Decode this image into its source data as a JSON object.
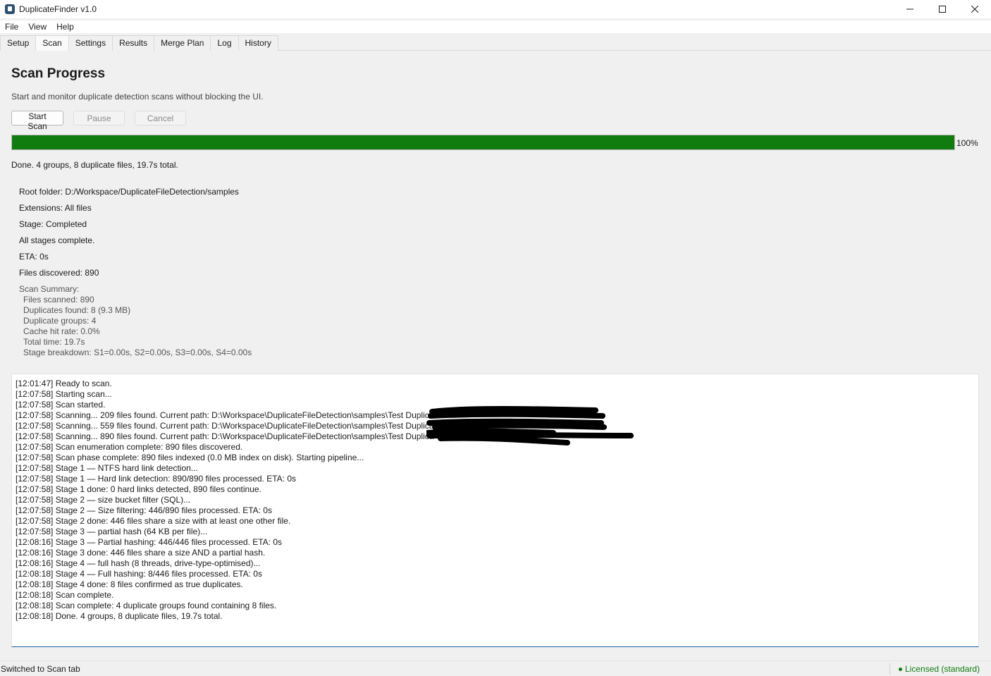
{
  "window": {
    "title": "DuplicateFinder v1.0"
  },
  "menu": [
    "File",
    "View",
    "Help"
  ],
  "tabs": [
    {
      "label": "Setup"
    },
    {
      "label": "Scan",
      "active": true
    },
    {
      "label": "Settings"
    },
    {
      "label": "Results"
    },
    {
      "label": "Merge Plan"
    },
    {
      "label": "Log"
    },
    {
      "label": "History"
    }
  ],
  "page": {
    "title": "Scan Progress",
    "subtitle": "Start and monitor duplicate detection scans without blocking the UI."
  },
  "buttons": {
    "start": "Start Scan",
    "pause": "Pause",
    "cancel": "Cancel"
  },
  "progress": {
    "value_percent": 100,
    "label": "100%",
    "color": "#107c10"
  },
  "done_line": "Done. 4 groups, 8 duplicate files, 19.7s total.",
  "info": [
    "Root folder: D:/Workspace/DuplicateFileDetection/samples",
    "Extensions: All files",
    "Stage: Completed",
    "All stages complete.",
    "ETA: 0s",
    "Files discovered: 890"
  ],
  "summary": {
    "title": "Scan Summary:",
    "items": [
      "Files scanned: 890",
      "Duplicates found: 8 (9.3 MB)",
      "Duplicate groups: 4",
      "Cache hit rate: 0.0%",
      "Total time: 19.7s",
      "Stage breakdown: S1=0.00s, S2=0.00s, S3=0.00s, S4=0.00s"
    ]
  },
  "log": [
    "[12:01:47] Ready to scan.",
    "[12:07:58] Starting scan...",
    "[12:07:58] Scan started.",
    "[12:07:58] Scanning... 209 files found. Current path: D:\\Workspace\\DuplicateFileDetection\\samples\\Test Duplicat",
    "[12:07:58] Scanning... 559 files found. Current path: D:\\Workspace\\DuplicateFileDetection\\samples\\Test Duplicat",
    "[12:07:58] Scanning... 890 files found. Current path: D:\\Workspace\\DuplicateFileDetection\\samples\\Test Duplica",
    "[12:07:58] Scan enumeration complete: 890 files discovered.",
    "[12:07:58] Scan phase complete: 890 files indexed (0.0 MB index on disk). Starting pipeline...",
    "[12:07:58] Stage 1 — NTFS hard link detection...",
    "[12:07:58] Stage 1 — Hard link detection: 890/890 files processed. ETA: 0s",
    "[12:07:58] Stage 1 done: 0 hard links detected, 890 files continue.",
    "[12:07:58] Stage 2 — size bucket filter (SQL)...",
    "[12:07:58] Stage 2 — Size filtering: 446/890 files processed. ETA: 0s",
    "[12:07:58] Stage 2 done: 446 files share a size with at least one other file.",
    "[12:07:58] Stage 3 — partial hash (64 KB per file)...",
    "[12:08:16] Stage 3 — Partial hashing: 446/446 files processed. ETA: 0s",
    "[12:08:16] Stage 3 done: 446 files share a size AND a partial hash.",
    "[12:08:16] Stage 4 — full hash (8 threads, drive-type-optimised)...",
    "[12:08:18] Stage 4 — Full hashing: 8/446 files processed. ETA: 0s",
    "[12:08:18] Stage 4 done: 8 files confirmed as true duplicates.",
    "[12:08:18] Scan complete.",
    "[12:08:18] Scan complete: 4 duplicate groups found containing 8 files.",
    "[12:08:18] Done. 4 groups, 8 duplicate files, 19.7s total."
  ],
  "status": {
    "left": "Switched to Scan tab",
    "right": "Licensed (standard)",
    "right_color": "#107c10"
  },
  "icons": {
    "app": "app-icon",
    "minimize": "minimize-icon",
    "maximize": "maximize-icon",
    "close": "close-icon",
    "license_dot": "status-dot-icon"
  }
}
